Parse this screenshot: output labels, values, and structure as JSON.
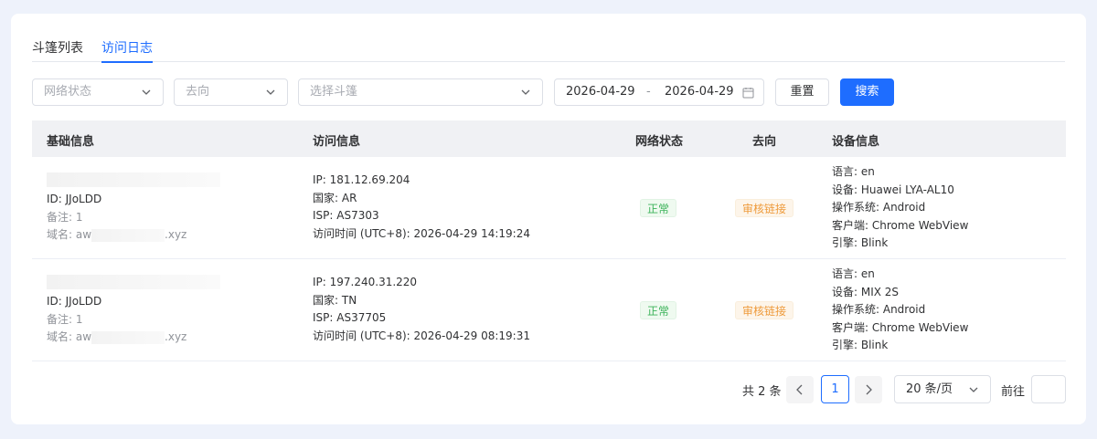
{
  "tabs": [
    {
      "label": "斗篷列表",
      "active": false
    },
    {
      "label": "访问日志",
      "active": true
    }
  ],
  "filters": {
    "network_status_placeholder": "网络状态",
    "direction_placeholder": "去向",
    "cloak_placeholder": "选择斗篷",
    "date_start": "2026-04-29",
    "date_separator": "-",
    "date_end": "2026-04-29",
    "reset_label": "重置",
    "search_label": "搜索"
  },
  "table": {
    "columns": [
      "基础信息",
      "访问信息",
      "网络状态",
      "去向",
      "设备信息"
    ],
    "rows": [
      {
        "basic": {
          "id": "ID: JJoLDD",
          "remark": "备注: 1",
          "domain_prefix": "域名: aw",
          "domain_suffix": ".xyz"
        },
        "visit": {
          "ip": "IP: 181.12.69.204",
          "country": "国家: AR",
          "isp": "ISP: AS7303",
          "time": "访问时间 (UTC+8): 2026-04-29 14:19:24"
        },
        "network_status": "正常",
        "direction": "审核链接",
        "device": {
          "language": "语言: en",
          "device": "设备: Huawei LYA-AL10",
          "os": "操作系统: Android",
          "client": "客户端: Chrome WebView",
          "engine": "引擎: Blink"
        }
      },
      {
        "basic": {
          "id": "ID: JJoLDD",
          "remark": "备注: 1",
          "domain_prefix": "域名: aw",
          "domain_suffix": ".xyz"
        },
        "visit": {
          "ip": "IP: 197.240.31.220",
          "country": "国家: TN",
          "isp": "ISP: AS37705",
          "time": "访问时间 (UTC+8): 2026-04-29 08:19:31"
        },
        "network_status": "正常",
        "direction": "审核链接",
        "device": {
          "language": "语言: en",
          "device": "设备: MIX 2S",
          "os": "操作系统: Android",
          "client": "客户端: Chrome WebView",
          "engine": "引擎: Blink"
        }
      }
    ]
  },
  "pagination": {
    "total": "共 2 条",
    "current_page": "1",
    "page_size": "20 条/页",
    "goto_label": "前往",
    "goto_value": ""
  },
  "colors": {
    "primary": "#1e6dff",
    "status_ok": "#3cb35a",
    "status_warn": "#ee9a3a"
  },
  "icons": [
    "chevron-down-icon",
    "calendar-icon",
    "chevron-left-icon",
    "chevron-right-icon"
  ]
}
